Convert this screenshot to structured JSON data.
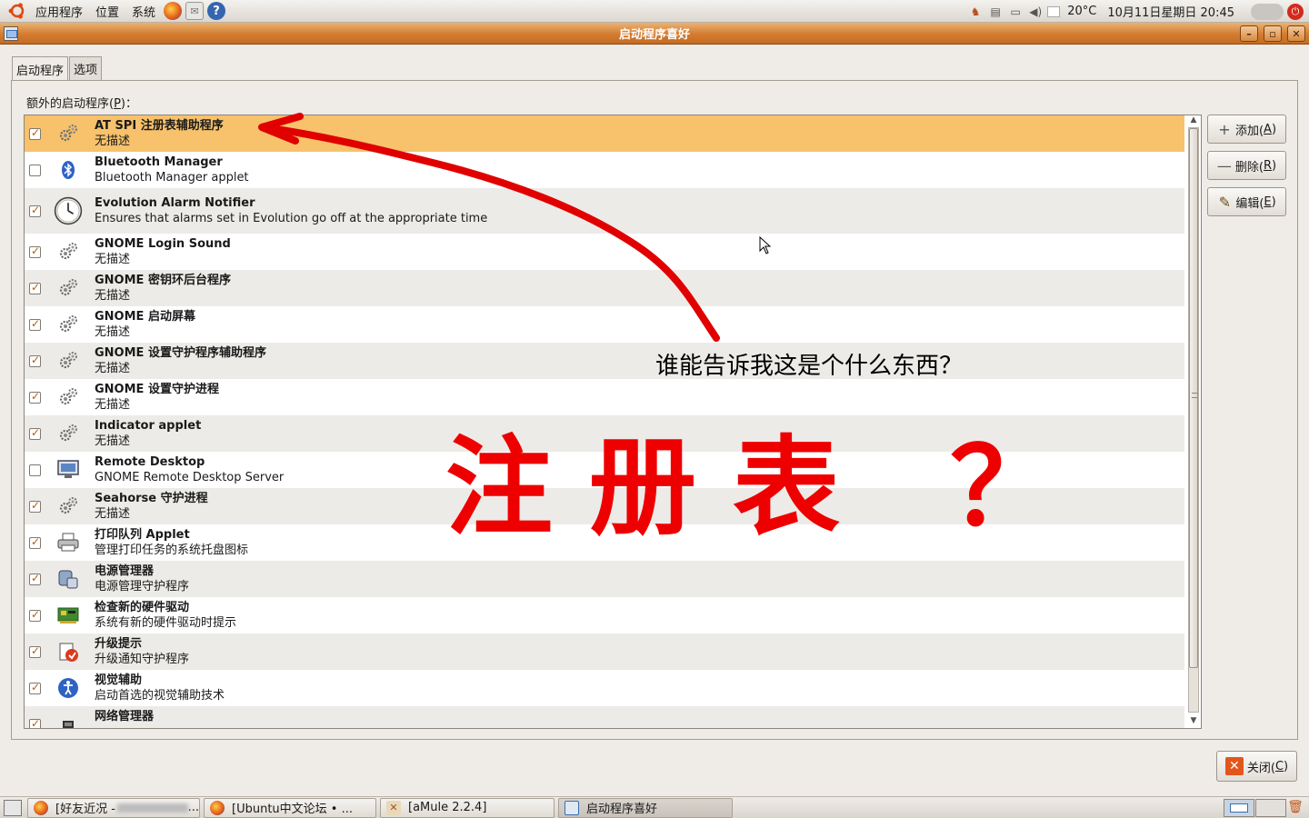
{
  "top_panel": {
    "menus": [
      "应用程序",
      "位置",
      "系统"
    ],
    "weather": "20°C",
    "clock": "10月11日星期日 20:45"
  },
  "window": {
    "title": "启动程序喜好",
    "minimize_glyph": "–",
    "maximize_glyph": "▫",
    "close_glyph": "✕"
  },
  "tabs": [
    {
      "label": "启动程序",
      "active": true
    },
    {
      "label": "选项",
      "active": false
    }
  ],
  "list_label_prefix": "额外的启动程序(",
  "list_label_key": "P",
  "list_label_suffix": ")：",
  "startup_items": [
    {
      "name": "AT SPI 注册表辅助程序",
      "desc": "无描述",
      "checked": true,
      "icon": "gears-icon",
      "selected": true
    },
    {
      "name": "Bluetooth Manager",
      "desc": "Bluetooth Manager applet",
      "checked": false,
      "icon": "bluetooth-icon"
    },
    {
      "name": "Evolution Alarm Notifier",
      "desc": "Ensures that alarms set in Evolution go off at the appropriate time",
      "checked": true,
      "icon": "clock-icon"
    },
    {
      "name": "GNOME Login Sound",
      "desc": "无描述",
      "checked": true,
      "icon": "gears-icon"
    },
    {
      "name": "GNOME 密钥环后台程序",
      "desc": "无描述",
      "checked": true,
      "icon": "gears-icon"
    },
    {
      "name": "GNOME 启动屏幕",
      "desc": "无描述",
      "checked": true,
      "icon": "gears-icon"
    },
    {
      "name": "GNOME 设置守护程序辅助程序",
      "desc": "无描述",
      "checked": true,
      "icon": "gears-icon"
    },
    {
      "name": "GNOME 设置守护进程",
      "desc": "无描述",
      "checked": true,
      "icon": "gears-icon"
    },
    {
      "name": "Indicator applet",
      "desc": "无描述",
      "checked": true,
      "icon": "gears-icon"
    },
    {
      "name": "Remote Desktop",
      "desc": "GNOME Remote Desktop Server",
      "checked": false,
      "icon": "monitor-icon"
    },
    {
      "name": "Seahorse 守护进程",
      "desc": "无描述",
      "checked": true,
      "icon": "gears-icon"
    },
    {
      "name": "打印队列 Applet",
      "desc": "管理打印任务的系统托盘图标",
      "checked": true,
      "icon": "printer-icon"
    },
    {
      "name": "电源管理器",
      "desc": "电源管理守护程序",
      "checked": true,
      "icon": "power-icon"
    },
    {
      "name": "检查新的硬件驱动",
      "desc": "系统有新的硬件驱动时提示",
      "checked": true,
      "icon": "hardware-card-icon"
    },
    {
      "name": "升级提示",
      "desc": "升级通知守护程序",
      "checked": true,
      "icon": "update-icon"
    },
    {
      "name": "视觉辅助",
      "desc": "启动首选的视觉辅助技术",
      "checked": true,
      "icon": "accessibility-icon"
    },
    {
      "name": "网络管理器",
      "desc": "",
      "checked": true,
      "icon": "network-icon"
    }
  ],
  "buttons": {
    "add": {
      "prefix": "添加(",
      "key": "A",
      "suffix": ")"
    },
    "remove": {
      "prefix": "删除(",
      "key": "R",
      "suffix": ")"
    },
    "edit": {
      "prefix": "编辑(",
      "key": "E",
      "suffix": ")"
    },
    "close": {
      "prefix": "关闭(",
      "key": "C",
      "suffix": ")"
    }
  },
  "taskbar": [
    {
      "label": "[好友近况 - ",
      "icon": "firefox-icon",
      "active": false
    },
    {
      "label": "[Ubuntu中文论坛 • ...",
      "icon": "firefox-icon",
      "active": false
    },
    {
      "label": "[aMule 2.2.4]",
      "icon": "amule-icon",
      "active": false
    },
    {
      "label": "启动程序喜好",
      "icon": "window-icon",
      "active": true
    }
  ],
  "annotation": {
    "question": "谁能告诉我这是个什么东西？",
    "big": "注册表 ？",
    "color": "#e00000"
  },
  "colors": {
    "titlebar": "#d37c30",
    "selected_row": "#f7c26b",
    "check_mark": "#b45f0a"
  }
}
